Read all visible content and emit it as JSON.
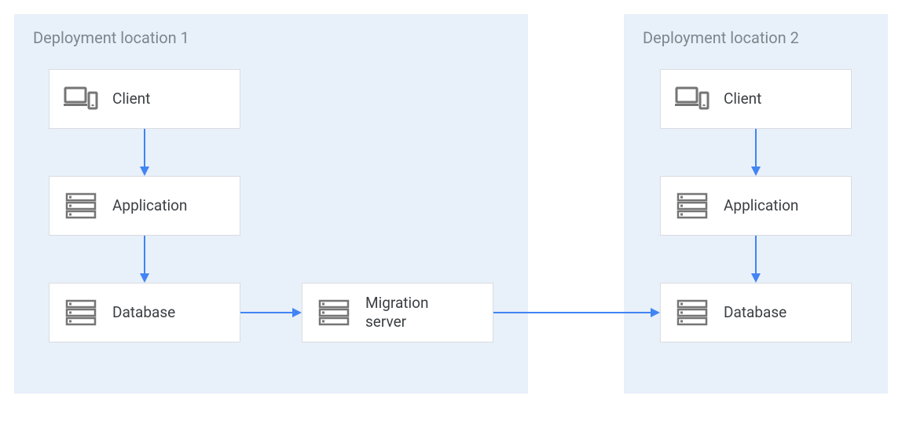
{
  "regions": {
    "loc1": {
      "title": "Deployment location 1"
    },
    "loc2": {
      "title": "Deployment location 2"
    }
  },
  "nodes": {
    "client1": {
      "label": "Client"
    },
    "app1": {
      "label": "Application"
    },
    "db1": {
      "label": "Database"
    },
    "migration": {
      "label": "Migration\nserver"
    },
    "client2": {
      "label": "Client"
    },
    "app2": {
      "label": "Application"
    },
    "db2": {
      "label": "Database"
    }
  },
  "colors": {
    "regionBg": "#e8f0fa",
    "nodeBorder": "#dadce0",
    "arrow": "#4284f3",
    "iconGray": "#757575"
  }
}
